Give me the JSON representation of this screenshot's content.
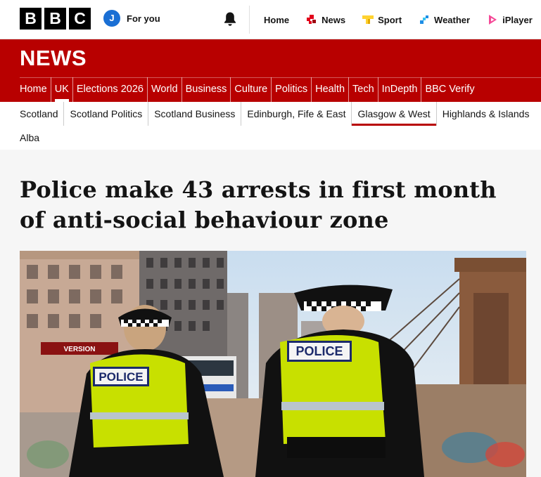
{
  "brand": {
    "letters": [
      "B",
      "B",
      "C"
    ]
  },
  "account": {
    "avatar_initial": "J",
    "label": "For you"
  },
  "icons": {
    "notifications": "bell-icon"
  },
  "top_nav": [
    {
      "label": "Home",
      "icon": ""
    },
    {
      "label": "News",
      "icon": "news-icon",
      "color": "#e2001a"
    },
    {
      "label": "Sport",
      "icon": "sport-icon",
      "color": "#ffd230"
    },
    {
      "label": "Weather",
      "icon": "weather-icon",
      "color": "#1d8ee6"
    },
    {
      "label": "iPlayer",
      "icon": "iplayer-icon",
      "color": "#f54997"
    }
  ],
  "section": {
    "title": "NEWS",
    "color": "#b80000"
  },
  "category_nav": [
    "Home",
    "UK",
    "Elections 2026",
    "World",
    "Business",
    "Culture",
    "Politics",
    "Health",
    "Tech",
    "InDepth",
    "BBC Verify"
  ],
  "category_active": "UK",
  "regional_nav": {
    "row1": [
      "Scotland",
      "Scotland Politics",
      "Scotland Business",
      "Edinburgh, Fife & East",
      "Glasgow & West",
      "Highlands & Islands"
    ],
    "row2": [
      "Alba"
    ],
    "active": "Glasgow & West"
  },
  "article": {
    "headline": "Police make 43 arrests in first month of anti-social behaviour zone",
    "image": {
      "vest_left": "POLICE",
      "vest_right": "POLICE",
      "bus_sign": "VERSION"
    }
  }
}
